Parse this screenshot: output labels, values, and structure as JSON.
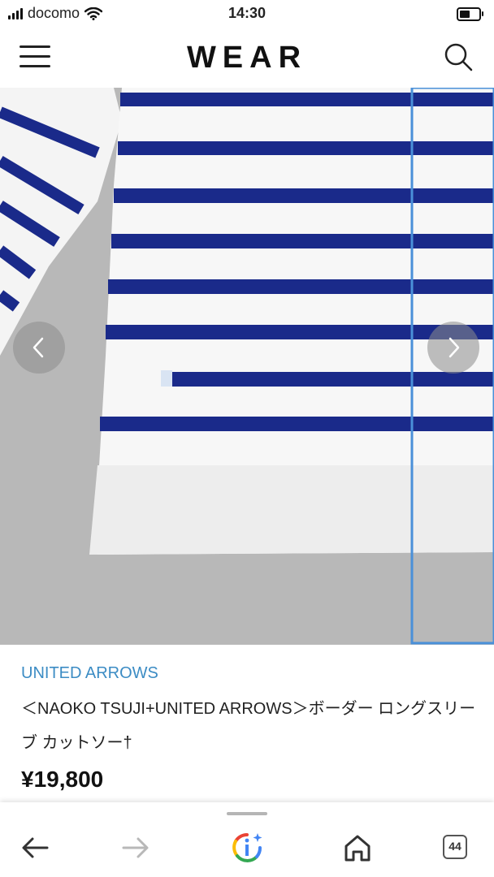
{
  "status_bar": {
    "carrier": "docomo",
    "time": "14:30"
  },
  "header": {
    "logo": "WEAR"
  },
  "product": {
    "brand": "UNITED ARROWS",
    "title": "＜NAOKO TSUJI+UNITED ARROWS＞ボーダー ロングスリーブ カットソー†",
    "price": "¥19,800"
  },
  "browser": {
    "tab_count": "44"
  },
  "colors": {
    "brand_link": "#3c8cc4",
    "stripe": "#1a2a8a",
    "highlight": "#4a90d9"
  },
  "icons": [
    "signal-icon",
    "wifi-icon",
    "battery-icon",
    "hamburger-menu-icon",
    "search-icon",
    "chevron-left-icon",
    "chevron-right-icon",
    "back-arrow-icon",
    "forward-arrow-icon",
    "google-assistant-icon",
    "home-icon",
    "tabs-icon"
  ]
}
